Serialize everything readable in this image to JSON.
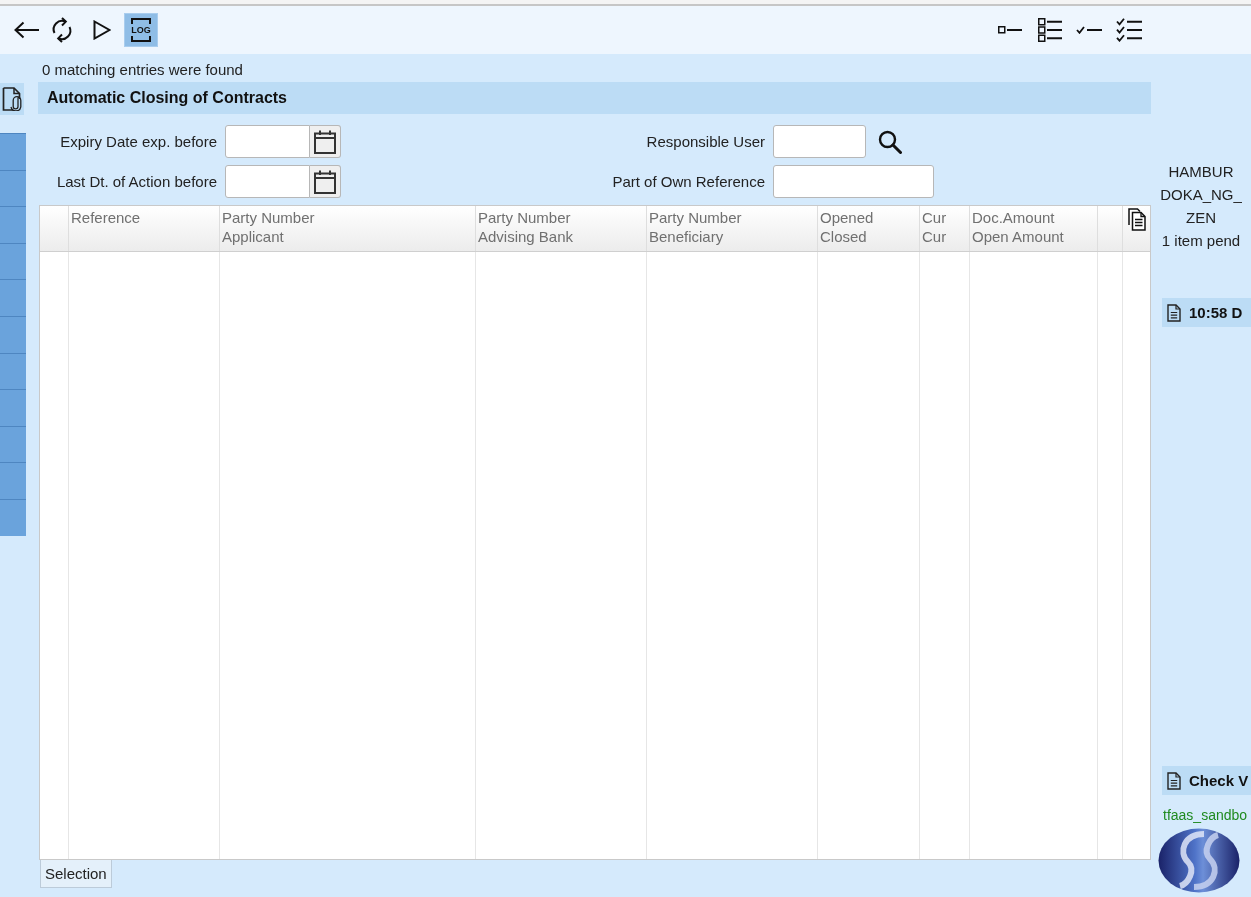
{
  "toolbar": {
    "log_button": {
      "label": "LOG",
      "on": true
    }
  },
  "status_message": "0 matching entries were found",
  "section_title": "Automatic Closing of Contracts",
  "form": {
    "fields": [
      {
        "label": "Expiry Date exp. before",
        "kind": "date"
      },
      {
        "label": "Responsible User",
        "kind": "lookup"
      },
      {
        "label": "Last Dt. of Action before",
        "kind": "date"
      },
      {
        "label": "Part of Own Reference",
        "kind": "text"
      }
    ]
  },
  "table": {
    "columns": [
      {
        "lines": [
          "Reference"
        ]
      },
      {
        "lines": [
          "Party Number",
          "Applicant"
        ]
      },
      {
        "lines": [
          "Party Number",
          "Advising Bank"
        ]
      },
      {
        "lines": [
          "Party Number",
          "Beneficiary"
        ]
      },
      {
        "lines": [
          "Opened",
          "Closed"
        ]
      },
      {
        "lines": [
          "Cur",
          "Cur"
        ]
      },
      {
        "lines": [
          "Doc.Amount",
          "Open Amount"
        ]
      }
    ]
  },
  "bottom_tabs": [
    {
      "label": "Selection",
      "selected": true
    }
  ],
  "right_panel": {
    "info_lines": [
      "HAMBUR",
      "DOKA_NG_",
      "ZEN",
      "1 item pend"
    ],
    "recent_entry": "10:58 D",
    "task_entry": "Check V",
    "environment": "tfaas_sandbo"
  }
}
